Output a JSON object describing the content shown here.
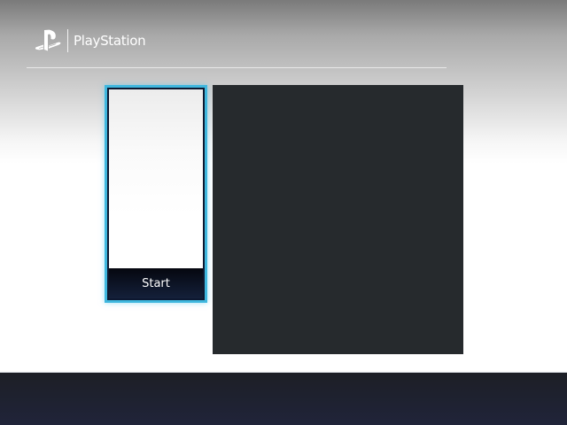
{
  "header": {
    "brand": "PlayStation",
    "logo_icon": "playstation-logo-icon"
  },
  "tiles": [
    {
      "label": "Start",
      "selected": true
    }
  ],
  "colors": {
    "accent": "#3fb7de",
    "panel": "#262a2d",
    "bottom_bar": "#1f2230"
  }
}
